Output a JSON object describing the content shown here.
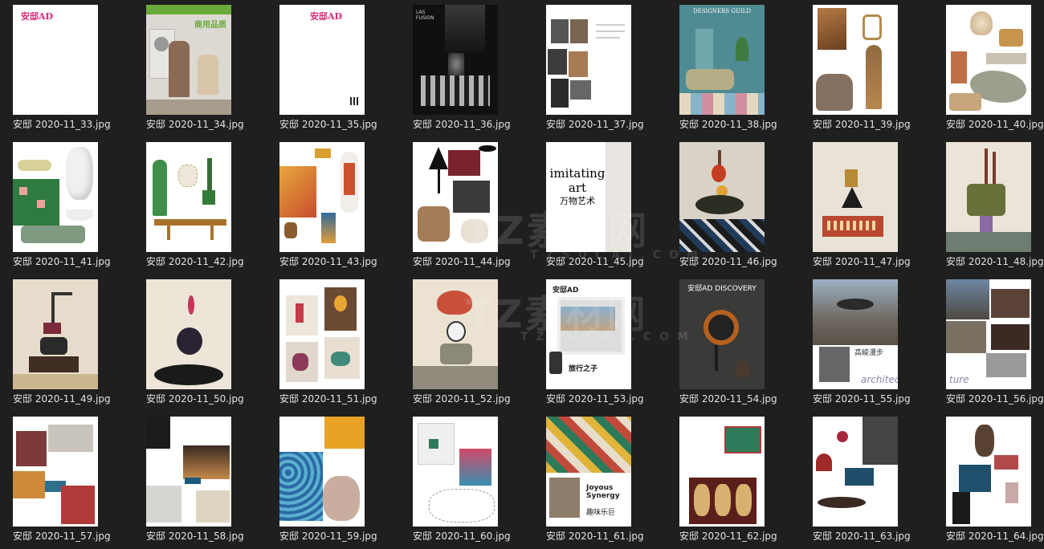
{
  "files": [
    "安邸 2020-11_33.jpg",
    "安邸 2020-11_34.jpg",
    "安邸 2020-11_35.jpg",
    "安邸 2020-11_36.jpg",
    "安邸 2020-11_37.jpg",
    "安邸 2020-11_38.jpg",
    "安邸 2020-11_39.jpg",
    "安邸 2020-11_40.jpg",
    "安邸 2020-11_41.jpg",
    "安邸 2020-11_42.jpg",
    "安邸 2020-11_43.jpg",
    "安邸 2020-11_44.jpg",
    "安邸 2020-11_45.jpg",
    "安邸 2020-11_46.jpg",
    "安邸 2020-11_47.jpg",
    "安邸 2020-11_48.jpg",
    "安邸 2020-11_49.jpg",
    "安邸 2020-11_50.jpg",
    "安邸 2020-11_51.jpg",
    "安邸 2020-11_52.jpg",
    "安邸 2020-11_53.jpg",
    "安邸 2020-11_54.jpg",
    "安邸 2020-11_55.jpg",
    "安邸 2020-11_56.jpg",
    "安邸 2020-11_57.jpg",
    "安邸 2020-11_58.jpg",
    "安邸 2020-11_59.jpg",
    "安邸 2020-11_60.jpg",
    "安邸 2020-11_61.jpg",
    "安邸 2020-11_62.jpg",
    "安邸 2020-11_63.jpg",
    "安邸 2020-11_64.jpg"
  ],
  "thumb_text": {
    "masthead": "安邸AD",
    "ad34_title": "商用品质",
    "ad36_title": "LAS FUSION",
    "ad38_title": "DESIGNERS GUILD",
    "art45_line1": "imitating",
    "art45_line2": "art",
    "art45_cn": "万物艺术",
    "ad54_masthead": "安邸AD DISCOVERY",
    "p55_cn": "高峻漫步",
    "p55_script": "architec",
    "p56_script": "ture",
    "p61_title": "Joyous Synergy",
    "p61_cn": "趣味乐巨",
    "p53_cn": "旅行之子"
  },
  "watermarks": [
    {
      "text": "TZ素材网"
    },
    {
      "text": "TZSUCAI.COM"
    },
    {
      "text": "TZ素材网"
    },
    {
      "text": "TZSUCAI.COM"
    }
  ]
}
